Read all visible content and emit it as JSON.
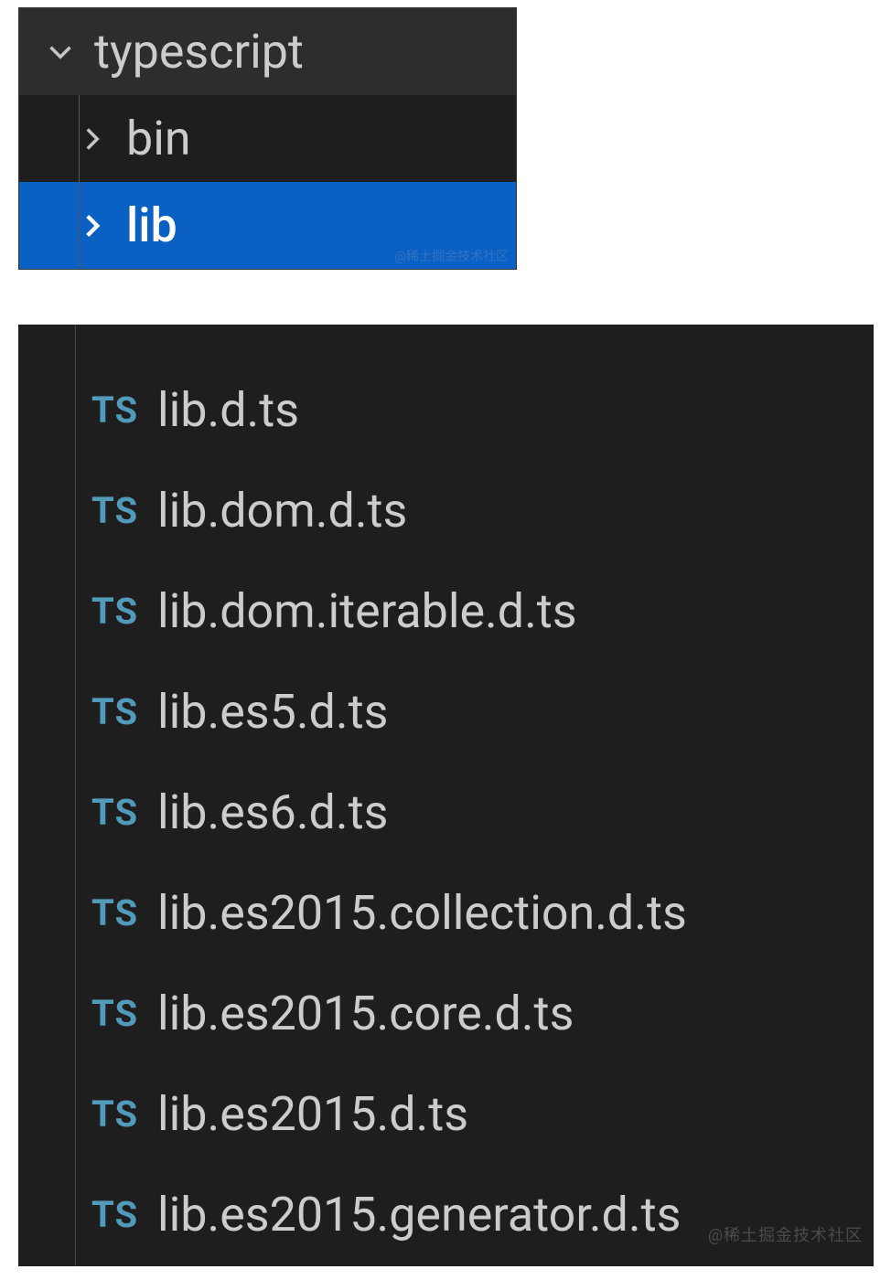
{
  "tree": {
    "root": {
      "label": "typescript",
      "expanded": true
    },
    "children": [
      {
        "label": "bin",
        "expanded": false,
        "selected": false
      },
      {
        "label": "lib",
        "expanded": false,
        "selected": true
      }
    ]
  },
  "files": [
    {
      "icon": "TS",
      "name": "lib.d.ts"
    },
    {
      "icon": "TS",
      "name": "lib.dom.d.ts"
    },
    {
      "icon": "TS",
      "name": "lib.dom.iterable.d.ts"
    },
    {
      "icon": "TS",
      "name": "lib.es5.d.ts"
    },
    {
      "icon": "TS",
      "name": "lib.es6.d.ts"
    },
    {
      "icon": "TS",
      "name": "lib.es2015.collection.d.ts"
    },
    {
      "icon": "TS",
      "name": "lib.es2015.core.d.ts"
    },
    {
      "icon": "TS",
      "name": "lib.es2015.d.ts"
    },
    {
      "icon": "TS",
      "name": "lib.es2015.generator.d.ts"
    }
  ],
  "watermarks": {
    "top": "@稀土掘金技术社区",
    "bottom": "@稀土掘金技术社区"
  }
}
